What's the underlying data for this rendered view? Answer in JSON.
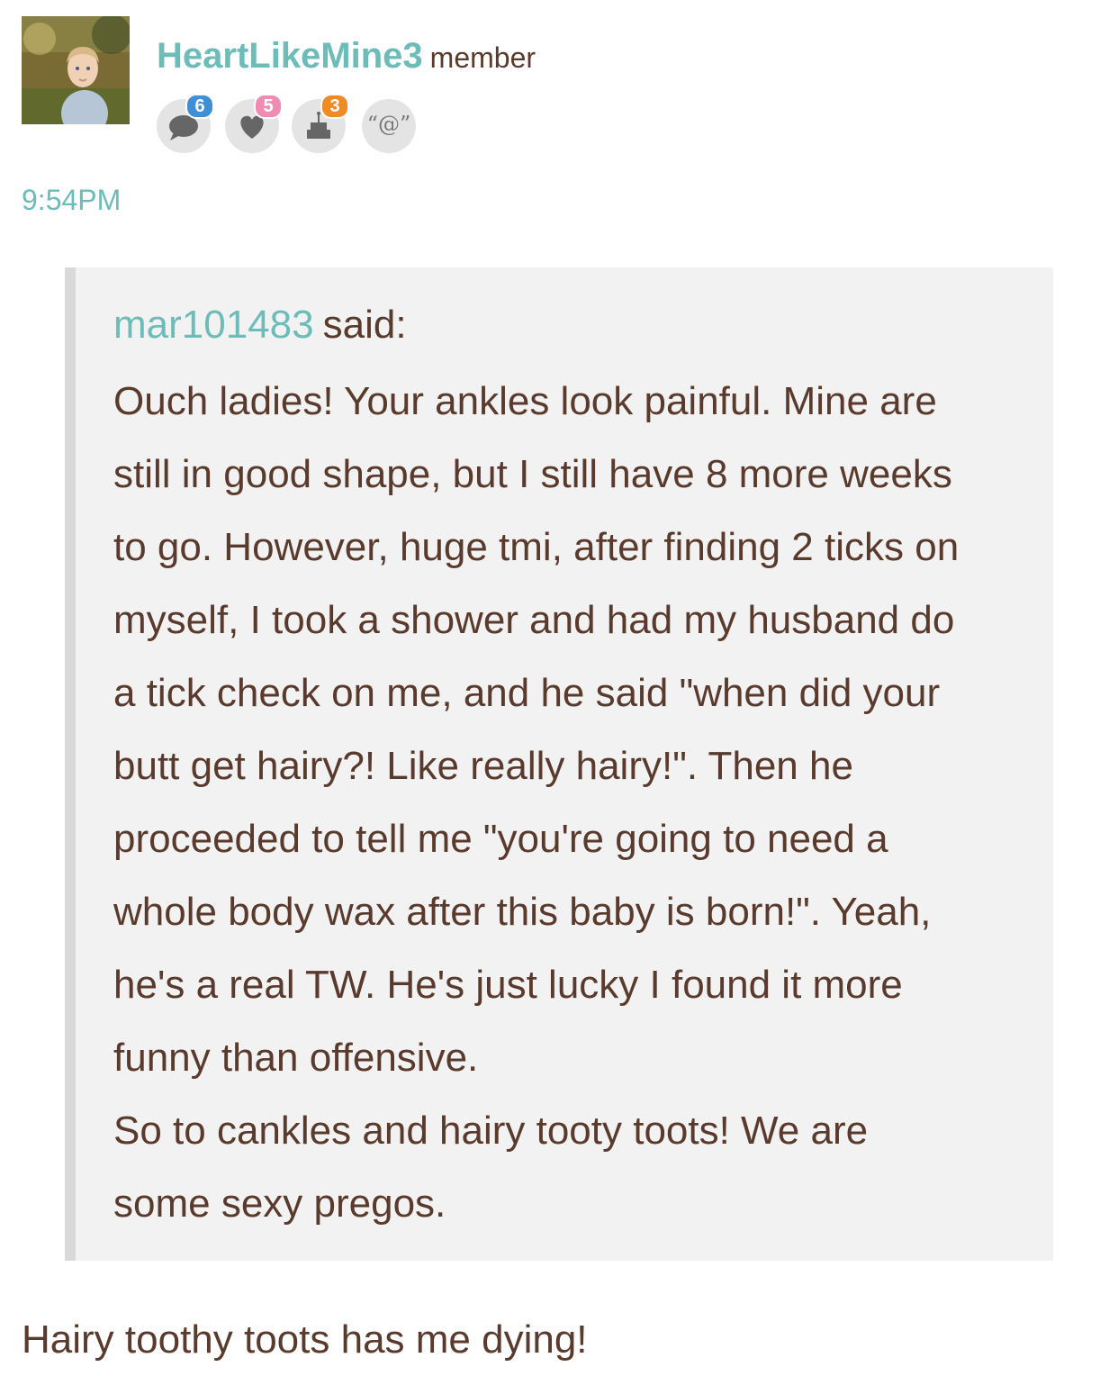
{
  "author": {
    "username": "HeartLikeMine3",
    "role": "member",
    "avatar_icon": "child-photo-avatar"
  },
  "badges": [
    {
      "icon": "comment-icon",
      "count": "6",
      "color": "#3d8fd6"
    },
    {
      "icon": "heart-icon",
      "count": "5",
      "color": "#f08cb4"
    },
    {
      "icon": "cake-icon",
      "count": "3",
      "color": "#f08a24"
    },
    {
      "icon": "mention-icon",
      "label": "“@”"
    }
  ],
  "timestamp": "9:54PM",
  "quote": {
    "author": "mar101483",
    "said_label": "said:",
    "paragraphs": [
      "Ouch ladies! Your ankles look painful. Mine are\nstill in good shape, but I still have 8 more weeks\nto go. However, huge tmi, after finding 2 ticks on\nmyself, I took a shower and had my husband do\na tick check on me, and he said \"when did your\nbutt get hairy?! Like really hairy!\". Then he\nproceeded to tell me \"you're going to need a\nwhole body wax after this baby is born!\". Yeah,\nhe's a real TW. He's just lucky I found it more\nfunny than offensive.",
      "So to cankles and hairy tooty toots! We are\nsome sexy pregos."
    ]
  },
  "reply_text": "Hairy toothy toots has me dying!",
  "colors": {
    "accent": "#6cbcba",
    "text": "#5a3a2c",
    "quote_bg": "#f2f2f2",
    "quote_border": "#d9d9d9"
  }
}
